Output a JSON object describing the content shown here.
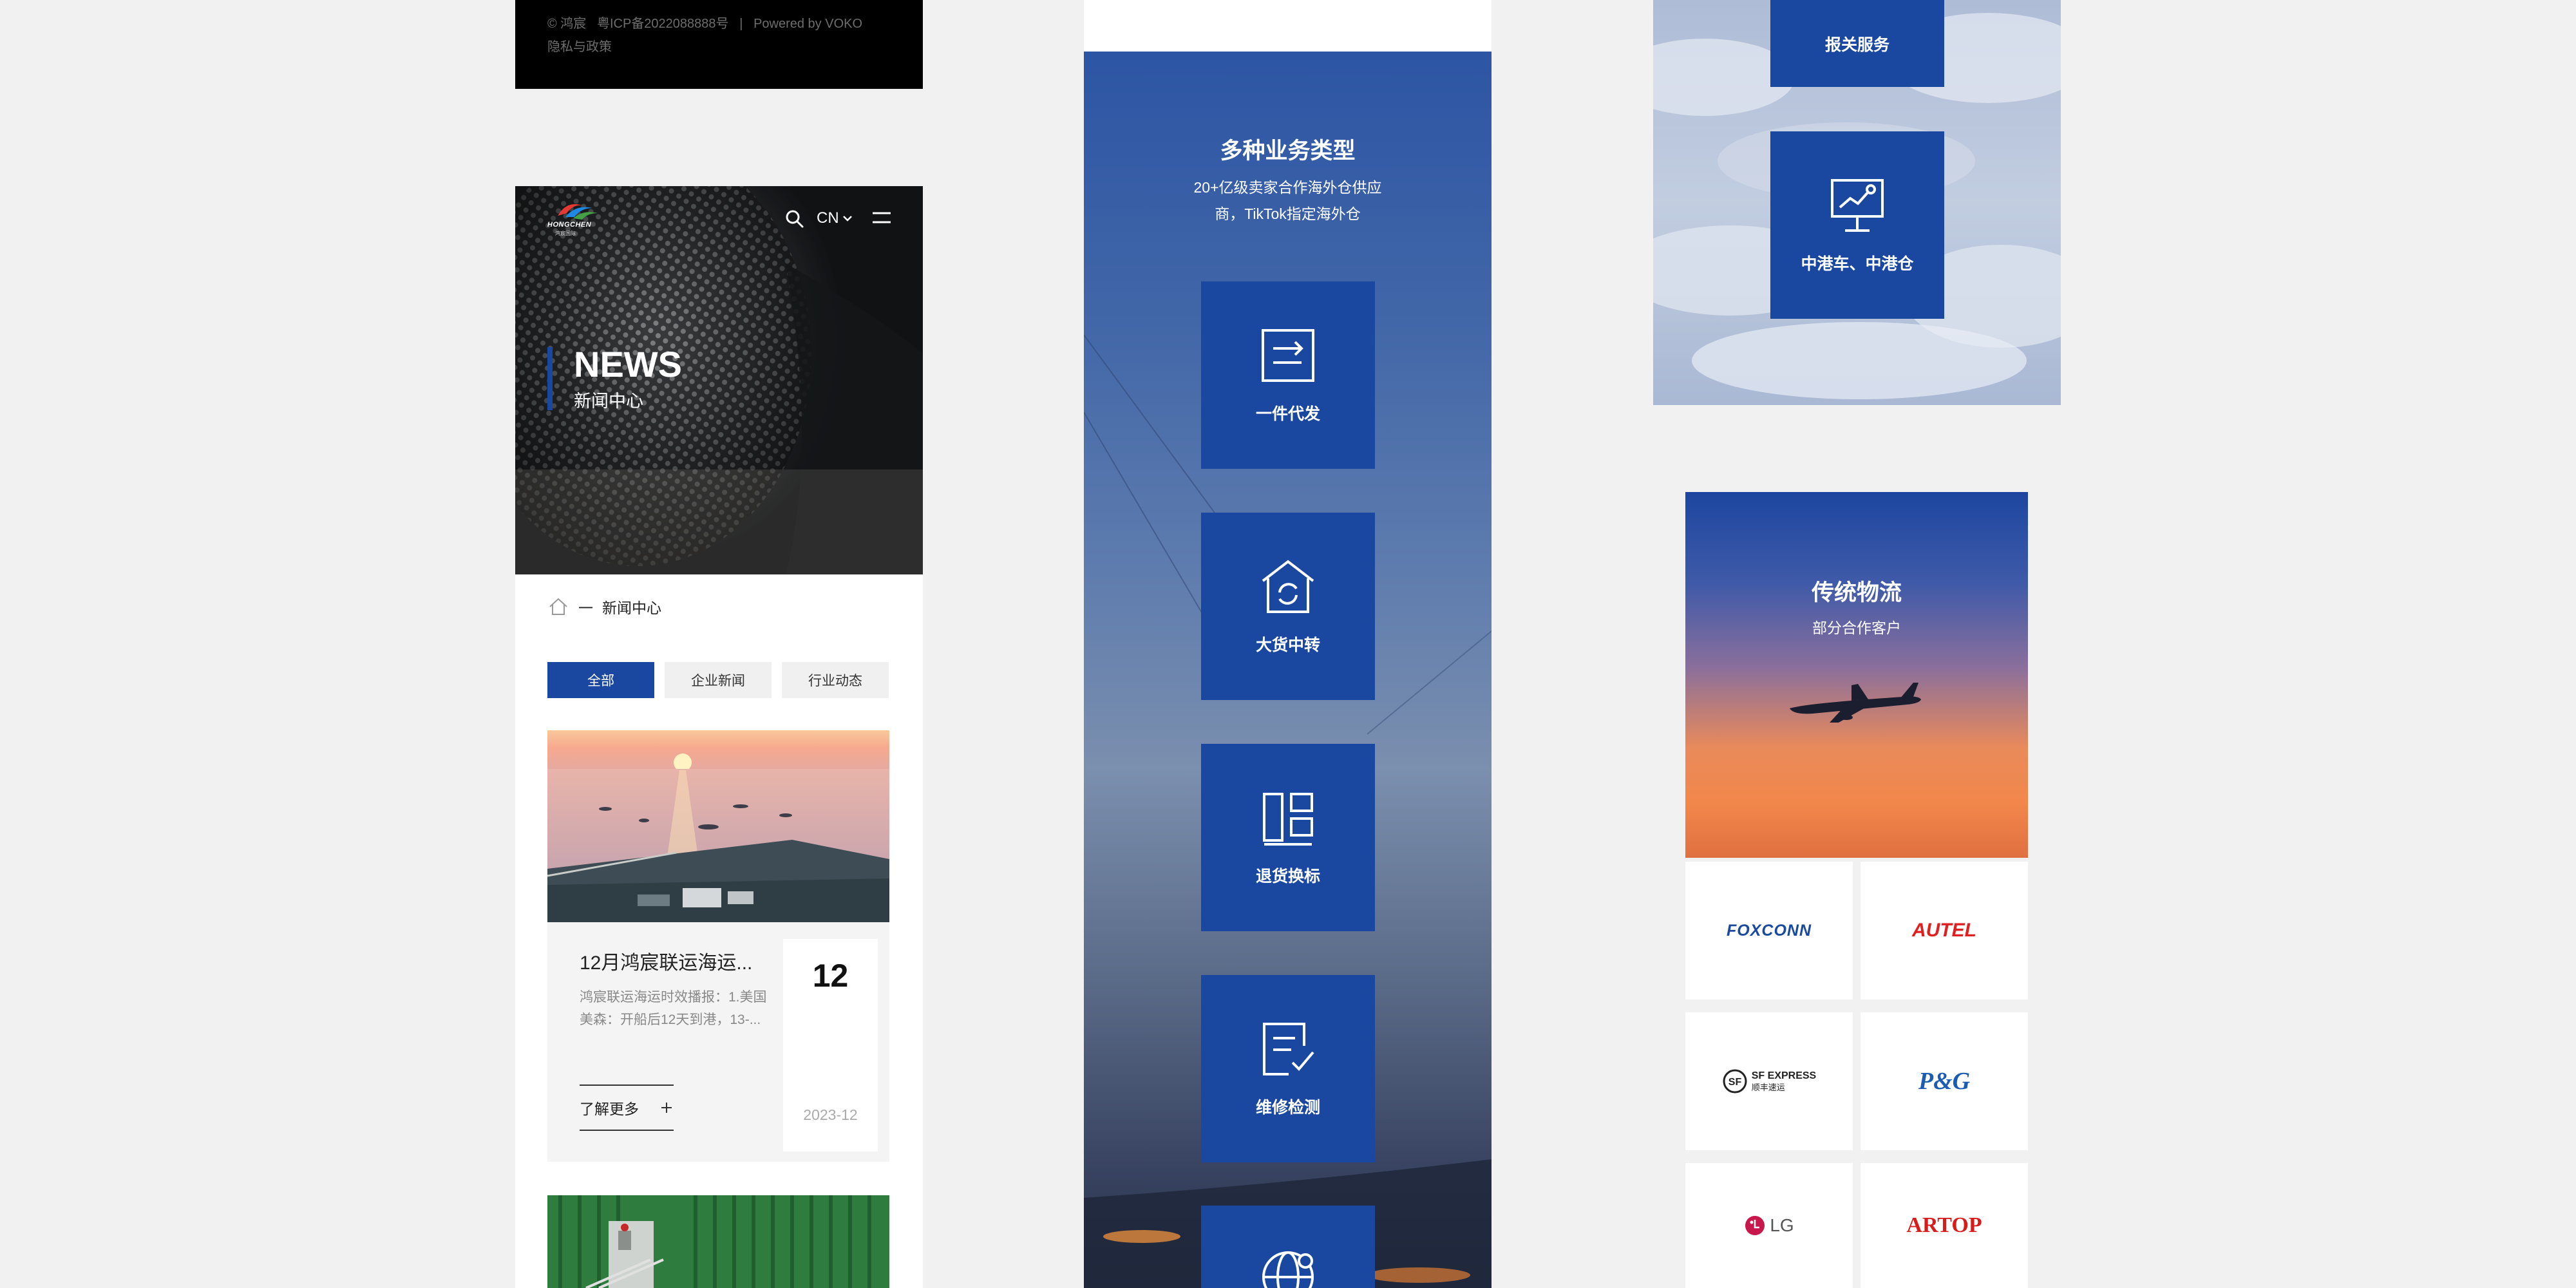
{
  "col1": {
    "footer": {
      "copyright": "© 鸿宸   粤ICP备2022088888号   |   Powered by VOKO",
      "privacy": "隐私与政策"
    },
    "header": {
      "brand": "HONGCHEN",
      "brand_sub": "鸿宸国际",
      "lang": "CN"
    },
    "hero": {
      "title": "NEWS",
      "subtitle": "新闻中心"
    },
    "breadcrumb": {
      "sep": "一",
      "current": "新闻中心"
    },
    "tabs": [
      "全部",
      "企业新闻",
      "行业动态"
    ],
    "news": [
      {
        "title": "12月鸿宸联运海运...",
        "excerpt_l1": "鸿宸联运海运时效播报：1.美国",
        "excerpt_l2": "美森：开船后12天到港，13-...",
        "more": "了解更多",
        "day": "12",
        "date": "2023-12"
      }
    ]
  },
  "col2": {
    "title": "多种业务类型",
    "desc_l1": "20+亿级卖家合作海外仓供应",
    "desc_l2": "商，TikTok指定海外仓",
    "services": [
      "一件代发",
      "大货中转",
      "退货换标",
      "维修检测"
    ]
  },
  "col3": {
    "services": [
      "报关服务",
      "中港车、中港仓"
    ],
    "traditional": {
      "title": "传统物流",
      "subtitle": "部分合作客户"
    },
    "clients": [
      "FOXCONN",
      "AUTEL",
      "SF EXPRESS",
      "P&G",
      "LG",
      "ARTOP"
    ],
    "sf_cn": "顺丰速运"
  },
  "colors": {
    "brand_blue": "#1a47a0",
    "background": "#f1f1f1",
    "footer_black": "#000000"
  }
}
